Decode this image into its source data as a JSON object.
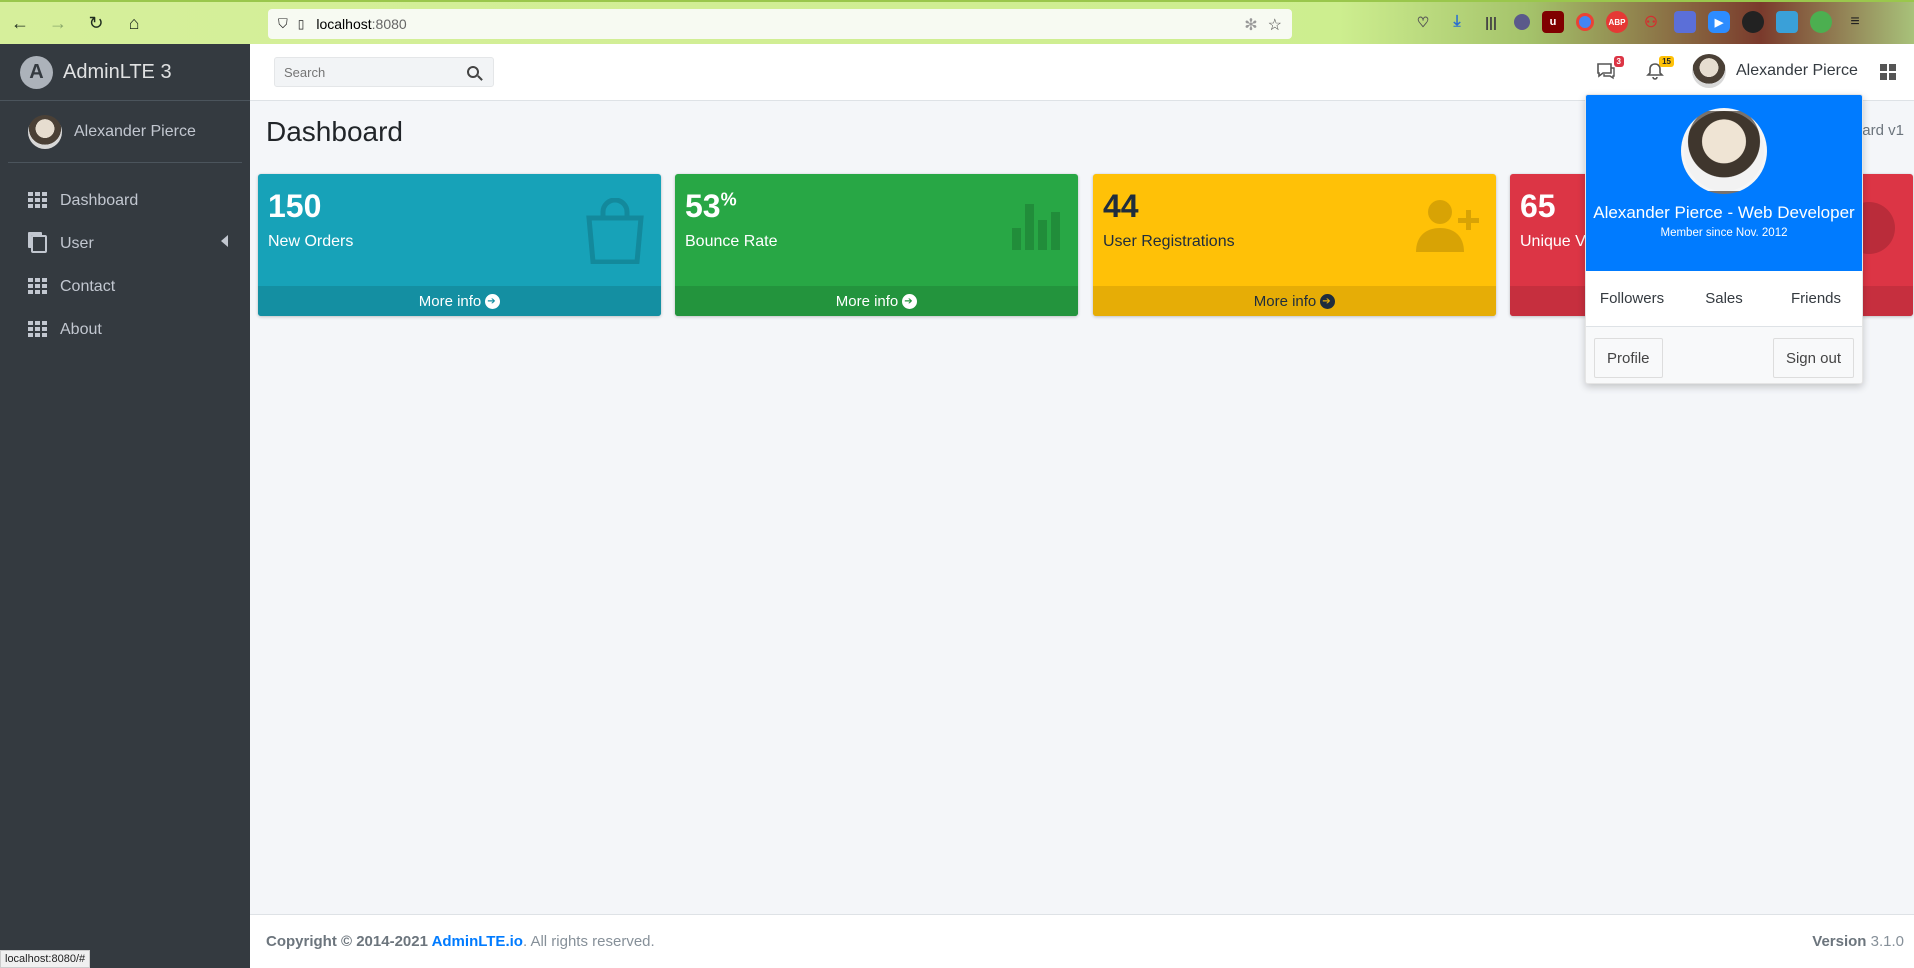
{
  "browser": {
    "url_host": "localhost",
    "url_port": ":8080",
    "status_url": "localhost:8080/#"
  },
  "sidebar": {
    "brand": "AdminLTE 3",
    "brand_logo_letter": "A",
    "user_name": "Alexander Pierce",
    "items": [
      {
        "label": "Dashboard",
        "icon": "grid-icon"
      },
      {
        "label": "User",
        "icon": "copy-icon",
        "has_children": true
      },
      {
        "label": "Contact",
        "icon": "grid-icon"
      },
      {
        "label": "About",
        "icon": "grid-icon"
      }
    ]
  },
  "header": {
    "search_placeholder": "Search",
    "messages_count": "3",
    "notifications_count": "15",
    "user_name": "Alexander Pierce"
  },
  "content": {
    "title": "Dashboard",
    "breadcrumb": "ard v1",
    "boxes": [
      {
        "value": "150",
        "suffix": "",
        "label": "New Orders",
        "link": "More info",
        "color": "#17a2b8"
      },
      {
        "value": "53",
        "suffix": "%",
        "label": "Bounce Rate",
        "link": "More info",
        "color": "#28a745"
      },
      {
        "value": "44",
        "suffix": "",
        "label": "User Registrations",
        "link": "More info",
        "color": "#ffc107"
      },
      {
        "value": "65",
        "suffix": "",
        "label": "Unique Vi",
        "link": "",
        "color": "#dc3545"
      }
    ]
  },
  "user_dropdown": {
    "name_line": "Alexander Pierce - Web Developer",
    "member_since": "Member since Nov. 2012",
    "links": [
      "Followers",
      "Sales",
      "Friends"
    ],
    "profile_label": "Profile",
    "signout_label": "Sign out",
    "header_color": "#007bff"
  },
  "footer": {
    "copyright_prefix": "Copyright © 2014-2021 ",
    "site_link": "AdminLTE.io",
    "suffix": ". All rights reserved.",
    "version_label": "Version",
    "version_number": " 3.1.0"
  }
}
